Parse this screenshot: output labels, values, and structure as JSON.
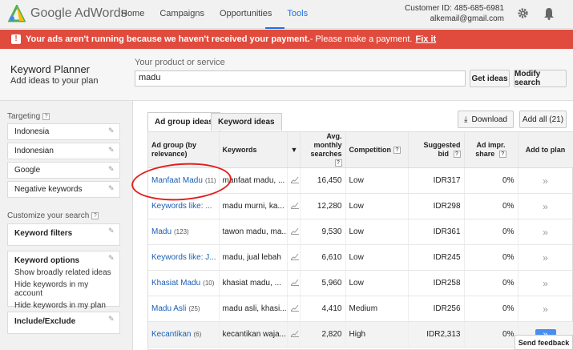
{
  "header": {
    "logo_text": "Google AdWords",
    "nav": [
      "Home",
      "Campaigns",
      "Opportunities",
      "Tools"
    ],
    "active_nav": "Tools",
    "customer_id": "Customer ID: 485-685-6981",
    "email": "alkemail@gmail.com"
  },
  "alert": {
    "bold_text": "Your ads aren't running because we haven't received your payment.",
    "text": " - Please make a payment.",
    "link": "Fix it"
  },
  "planner": {
    "title": "Keyword Planner",
    "subtitle": "Add ideas to your plan",
    "product_label": "Your product or service",
    "product_value": "madu",
    "get_ideas": "Get ideas",
    "modify_search": "Modify search"
  },
  "sidebar": {
    "targeting_label": "Targeting",
    "targeting_items": [
      "Indonesia",
      "Indonesian",
      "Google",
      "Negative keywords"
    ],
    "customize_label": "Customize your search",
    "keyword_filters": "Keyword filters",
    "keyword_options": {
      "title": "Keyword options",
      "lines": [
        "Show broadly related ideas",
        "Hide keywords in my account",
        "Hide keywords in my plan"
      ]
    },
    "include_exclude": "Include/Exclude"
  },
  "main": {
    "tabs": [
      "Ad group ideas",
      "Keyword ideas"
    ],
    "download": "Download",
    "add_all": "Add all (21)",
    "columns": [
      "Ad group (by relevance)",
      "Keywords",
      "Avg. monthly searches",
      "Competition",
      "Suggested bid",
      "Ad impr. share",
      "Add to plan"
    ],
    "rows": [
      {
        "group": "Manfaat Madu",
        "count": "(11)",
        "keywords": "manfaat madu, ...",
        "searches": "16,450",
        "competition": "Low",
        "bid": "IDR317",
        "share": "0%"
      },
      {
        "group": "Keywords like: ...",
        "count": "",
        "keywords": "madu murni, ka...",
        "searches": "12,280",
        "competition": "Low",
        "bid": "IDR298",
        "share": "0%"
      },
      {
        "group": "Madu",
        "count": "(123)",
        "keywords": "tawon madu, ma...",
        "searches": "9,530",
        "competition": "Low",
        "bid": "IDR361",
        "share": "0%"
      },
      {
        "group": "Keywords like: J...",
        "count": "",
        "keywords": "madu, jual lebah",
        "searches": "6,610",
        "competition": "Low",
        "bid": "IDR245",
        "share": "0%"
      },
      {
        "group": "Khasiat Madu",
        "count": "(10)",
        "keywords": "khasiat madu, ...",
        "searches": "5,960",
        "competition": "Low",
        "bid": "IDR258",
        "share": "0%"
      },
      {
        "group": "Madu Asli",
        "count": "(25)",
        "keywords": "madu asli, khasi...",
        "searches": "4,410",
        "competition": "Medium",
        "bid": "IDR256",
        "share": "0%"
      },
      {
        "group": "Kecantikan",
        "count": "(6)",
        "keywords": "kecantikan waja...",
        "searches": "2,820",
        "competition": "High",
        "bid": "IDR2,313",
        "share": "0%"
      }
    ]
  },
  "feedback": "Send feedback",
  "colors": {
    "alert": "#e04b3d",
    "accent": "#1a73e8",
    "link": "#1a5fb4",
    "highlight_circle": "#e0201c"
  }
}
